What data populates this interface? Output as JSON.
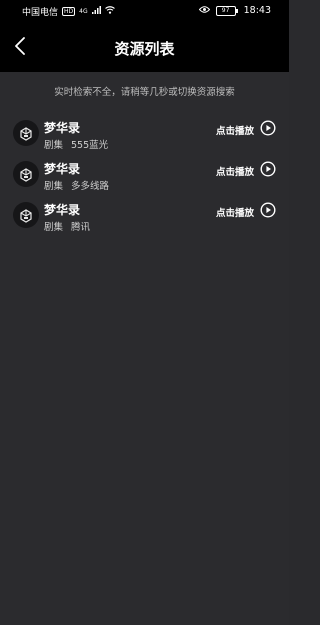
{
  "status_bar": {
    "carrier": "中国电信",
    "hd_badge": "HD",
    "network": "4G",
    "battery": "97",
    "time": "18:43"
  },
  "navbar": {
    "back_icon": "chevron-left-icon",
    "title": "资源列表"
  },
  "hint": "实时检索不全，请稍等几秒或切换资源搜索",
  "resources": [
    {
      "name": "梦华录",
      "type": "剧集",
      "source": "555蓝光",
      "play_label": "点击播放"
    },
    {
      "name": "梦华录",
      "type": "剧集",
      "source": "多多线路",
      "play_label": "点击播放"
    },
    {
      "name": "梦华录",
      "type": "剧集",
      "source": "腾讯",
      "play_label": "点击播放"
    }
  ],
  "colors": {
    "header_bg": "#000000",
    "page_bg": "#2b2b2e",
    "hint_text": "#bdbdbd"
  }
}
